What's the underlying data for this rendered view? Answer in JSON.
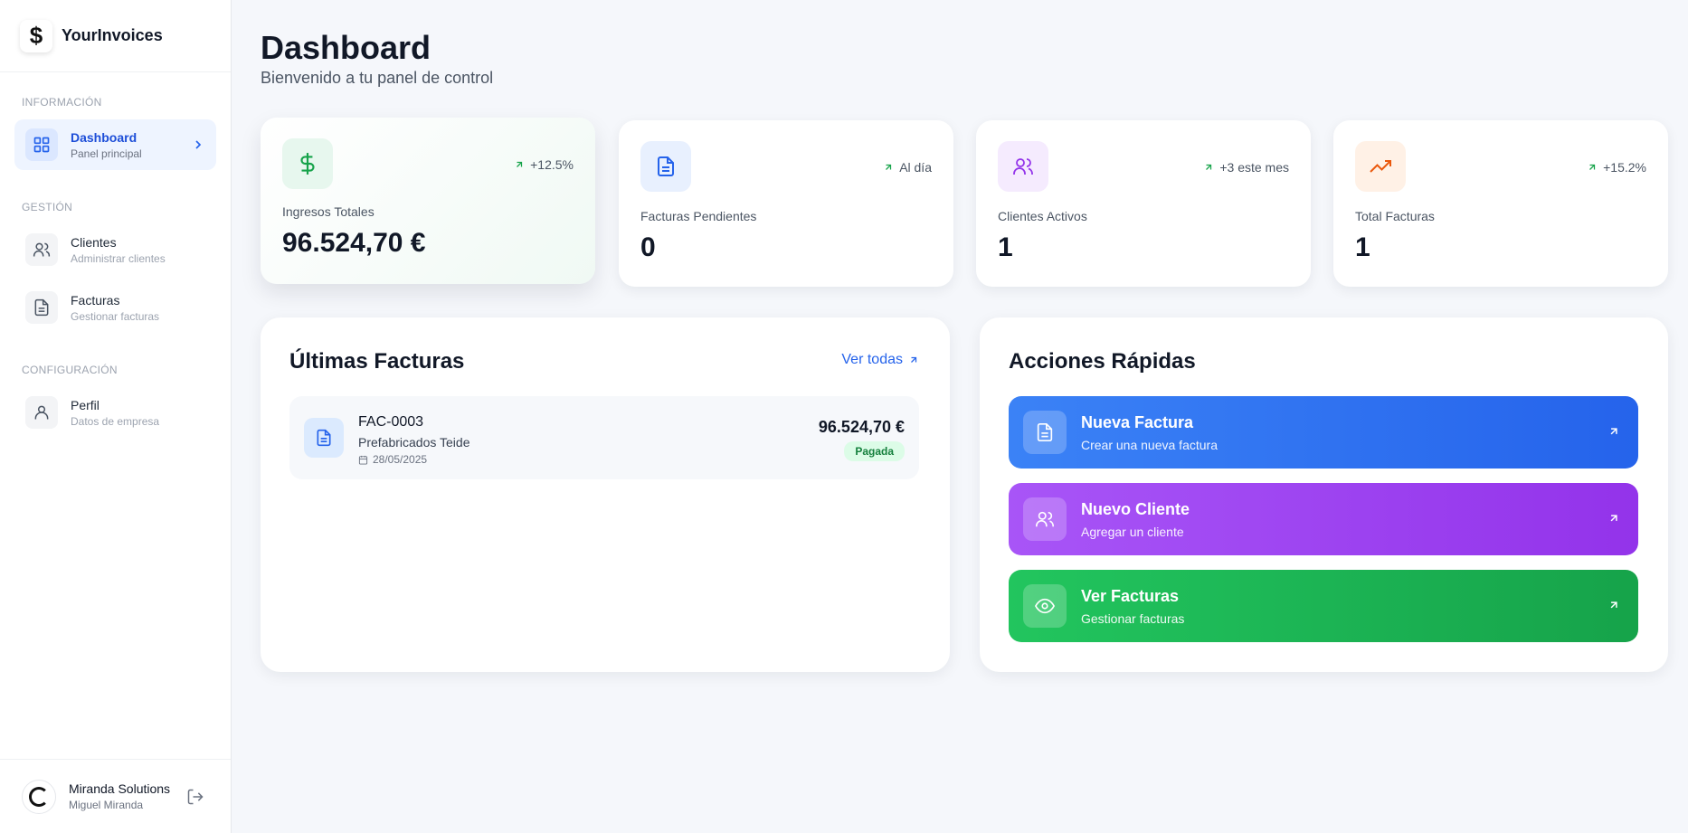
{
  "brand": {
    "logo_symbol": "$",
    "name": "YourInvoices"
  },
  "sidebar": {
    "sections": [
      {
        "title": "INFORMACIÓN"
      },
      {
        "title": "GESTIÓN"
      },
      {
        "title": "CONFIGURACIÓN"
      }
    ],
    "items": [
      {
        "label": "Dashboard",
        "sub": "Panel principal",
        "icon": "dashboard-grid-icon",
        "active": true
      },
      {
        "label": "Clientes",
        "sub": "Administrar clientes",
        "icon": "users-icon"
      },
      {
        "label": "Facturas",
        "sub": "Gestionar facturas",
        "icon": "document-icon"
      },
      {
        "label": "Perfil",
        "sub": "Datos de empresa",
        "icon": "user-icon"
      }
    ],
    "user": {
      "name": "Miranda Solutions",
      "sub": "Miguel Miranda"
    }
  },
  "header": {
    "title": "Dashboard",
    "subtitle": "Bienvenido a tu panel de control"
  },
  "stats": [
    {
      "label": "Ingresos Totales",
      "value": "96.524,70 €",
      "trend": "+12.5%",
      "icon": "dollar-icon",
      "color": "#16a34a"
    },
    {
      "label": "Facturas Pendientes",
      "value": "0",
      "trend": "Al día",
      "icon": "document-icon",
      "color": "#2563eb"
    },
    {
      "label": "Clientes Activos",
      "value": "1",
      "trend": "+3 este mes",
      "icon": "users-icon",
      "color": "#9333ea"
    },
    {
      "label": "Total Facturas",
      "value": "1",
      "trend": "+15.2%",
      "icon": "trending-up-icon",
      "color": "#ea580c"
    }
  ],
  "latest": {
    "title": "Últimas Facturas",
    "see_all": "Ver todas",
    "invoices": [
      {
        "code": "FAC-0003",
        "client": "Prefabricados Teide",
        "date": "28/05/2025",
        "amount": "96.524,70 €",
        "status": "Pagada"
      }
    ]
  },
  "quick": {
    "title": "Acciones Rápidas",
    "actions": [
      {
        "title": "Nueva Factura",
        "sub": "Crear una nueva factura",
        "icon": "document-icon",
        "color": "#2563eb"
      },
      {
        "title": "Nuevo Cliente",
        "sub": "Agregar un cliente",
        "icon": "users-icon",
        "color": "#9333ea"
      },
      {
        "title": "Ver Facturas",
        "sub": "Gestionar facturas",
        "icon": "eye-icon",
        "color": "#16a34a"
      }
    ]
  }
}
